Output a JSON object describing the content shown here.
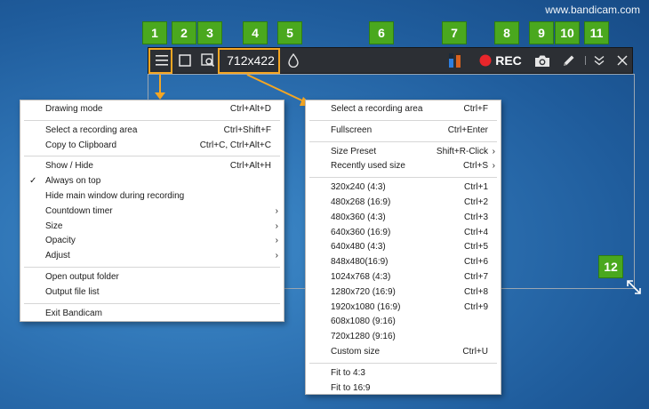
{
  "watermark": "www.bandicam.com",
  "toolbar": {
    "size_display": "712x422",
    "rec_label": "REC"
  },
  "badges": [
    "1",
    "2",
    "3",
    "4",
    "5",
    "6",
    "7",
    "8",
    "9",
    "10",
    "11",
    "12"
  ],
  "main_menu": {
    "groups": [
      [
        {
          "label": "Drawing mode",
          "shortcut": "Ctrl+Alt+D"
        }
      ],
      [
        {
          "label": "Select a recording area",
          "shortcut": "Ctrl+Shift+F"
        },
        {
          "label": "Copy to Clipboard",
          "shortcut": "Ctrl+C, Ctrl+Alt+C"
        }
      ],
      [
        {
          "label": "Show / Hide",
          "shortcut": "Ctrl+Alt+H"
        },
        {
          "label": "Always on top",
          "shortcut": "",
          "checked": true
        },
        {
          "label": "Hide main window during recording",
          "shortcut": ""
        },
        {
          "label": "Countdown timer",
          "shortcut": "",
          "submenu": true
        },
        {
          "label": "Size",
          "shortcut": "",
          "submenu": true
        },
        {
          "label": "Opacity",
          "shortcut": "",
          "submenu": true
        },
        {
          "label": "Adjust",
          "shortcut": "",
          "submenu": true
        }
      ],
      [
        {
          "label": "Open output folder",
          "shortcut": ""
        },
        {
          "label": "Output file list",
          "shortcut": ""
        }
      ],
      [
        {
          "label": "Exit Bandicam",
          "shortcut": ""
        }
      ]
    ]
  },
  "size_menu": {
    "groups": [
      [
        {
          "label": "Select a recording area",
          "shortcut": "Ctrl+F"
        }
      ],
      [
        {
          "label": "Fullscreen",
          "shortcut": "Ctrl+Enter"
        }
      ],
      [
        {
          "label": "Size Preset",
          "shortcut": "Shift+R-Click",
          "submenu": true
        },
        {
          "label": "Recently used size",
          "shortcut": "Ctrl+S",
          "submenu": true
        }
      ],
      [
        {
          "label": "320x240 (4:3)",
          "shortcut": "Ctrl+1"
        },
        {
          "label": "480x268 (16:9)",
          "shortcut": "Ctrl+2"
        },
        {
          "label": "480x360 (4:3)",
          "shortcut": "Ctrl+3"
        },
        {
          "label": "640x360 (16:9)",
          "shortcut": "Ctrl+4"
        },
        {
          "label": "640x480 (4:3)",
          "shortcut": "Ctrl+5"
        },
        {
          "label": "848x480(16:9)",
          "shortcut": "Ctrl+6"
        },
        {
          "label": "1024x768 (4:3)",
          "shortcut": "Ctrl+7"
        },
        {
          "label": "1280x720 (16:9)",
          "shortcut": "Ctrl+8"
        },
        {
          "label": "1920x1080 (16:9)",
          "shortcut": "Ctrl+9"
        },
        {
          "label": "608x1080 (9:16)",
          "shortcut": ""
        },
        {
          "label": "720x1280 (9:16)",
          "shortcut": ""
        },
        {
          "label": "Custom size",
          "shortcut": "Ctrl+U"
        }
      ],
      [
        {
          "label": "Fit to 4:3",
          "shortcut": ""
        },
        {
          "label": "Fit to 16:9",
          "shortcut": ""
        }
      ]
    ]
  },
  "colors": {
    "badge_green": "#4aa81e",
    "highlight_orange": "#f5a623",
    "toolbar_bg": "#2c2f34",
    "rec_red": "#e8262b",
    "level_blue": "#2e7fe0",
    "level_orange": "#d9621f"
  },
  "icons": [
    "menu-icon",
    "rectangle-icon",
    "window-search-icon",
    "opacity-drop-icon",
    "audio-level-icon",
    "record-icon",
    "camera-icon",
    "pencil-icon",
    "collapse-icon",
    "close-icon",
    "resize-icon"
  ]
}
